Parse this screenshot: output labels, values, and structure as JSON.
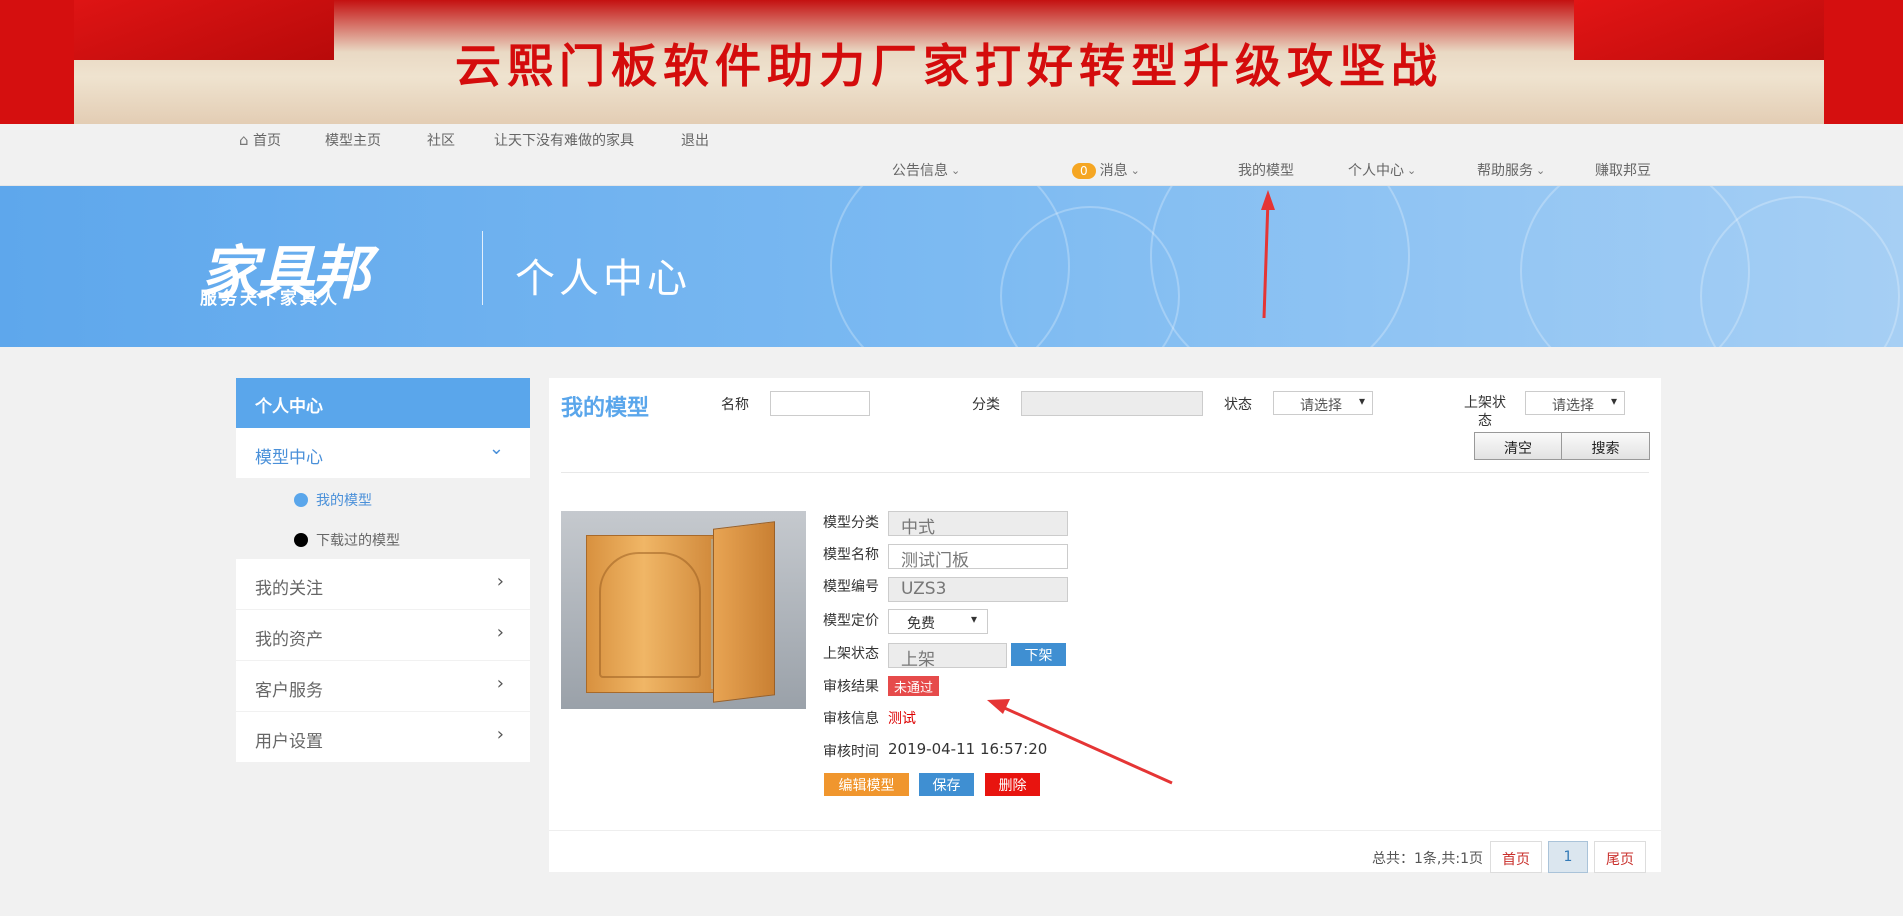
{
  "banner": {
    "text": "云熙门板软件助力厂家打好转型升级攻坚战"
  },
  "nav_top": {
    "home": "首页",
    "model_home": "模型主页",
    "community": "社区",
    "slogan": "让天下没有难做的家具",
    "logout": "退出"
  },
  "nav_second": {
    "announcements": "公告信息",
    "message_count": "0",
    "messages": "消息",
    "my_models": "我的模型",
    "personal_center": "个人中心",
    "help": "帮助服务",
    "earn": "赚取邦豆"
  },
  "hero": {
    "logo": "家具邦",
    "logo_sub": "服务天下家具人",
    "title": "个人中心"
  },
  "sidebar": {
    "header": "个人中心",
    "model_center": "模型中心",
    "my_models": "我的模型",
    "downloaded": "下载过的模型",
    "following": "我的关注",
    "assets": "我的资产",
    "service": "客户服务",
    "settings": "用户设置"
  },
  "filter": {
    "title": "我的模型",
    "name_label": "名称",
    "name_value": "",
    "category_label": "分类",
    "category_value": "",
    "status_label": "状态",
    "status_value": "请选择",
    "listing_label": "上架状态",
    "listing_value": "请选择",
    "clear": "清空",
    "search": "搜索"
  },
  "model": {
    "category_label": "模型分类",
    "category": "中式",
    "name_label": "模型名称",
    "name": "测试门板",
    "code_label": "模型编号",
    "code": "UZS3",
    "price_label": "模型定价",
    "price": "免费",
    "listing_label": "上架状态",
    "listing": "上架",
    "unlist_button": "下架",
    "review_result_label": "审核结果",
    "review_result": "未通过",
    "review_info_label": "审核信息",
    "review_info": "测试",
    "review_time_label": "审核时间",
    "review_time": "2019-04-11 16:57:20",
    "edit_button": "编辑模型",
    "save_button": "保存",
    "delete_button": "删除"
  },
  "pager": {
    "total": "总共：1条,共:1页",
    "first": "首页",
    "current": "1",
    "last": "尾页"
  },
  "colors": {
    "accent": "#5aa6eb",
    "banner_red": "#d50f0f",
    "edit": "#f0962e",
    "save": "#3f8fd2",
    "delete": "#e8140f",
    "fail_badge": "#e64b4b"
  }
}
